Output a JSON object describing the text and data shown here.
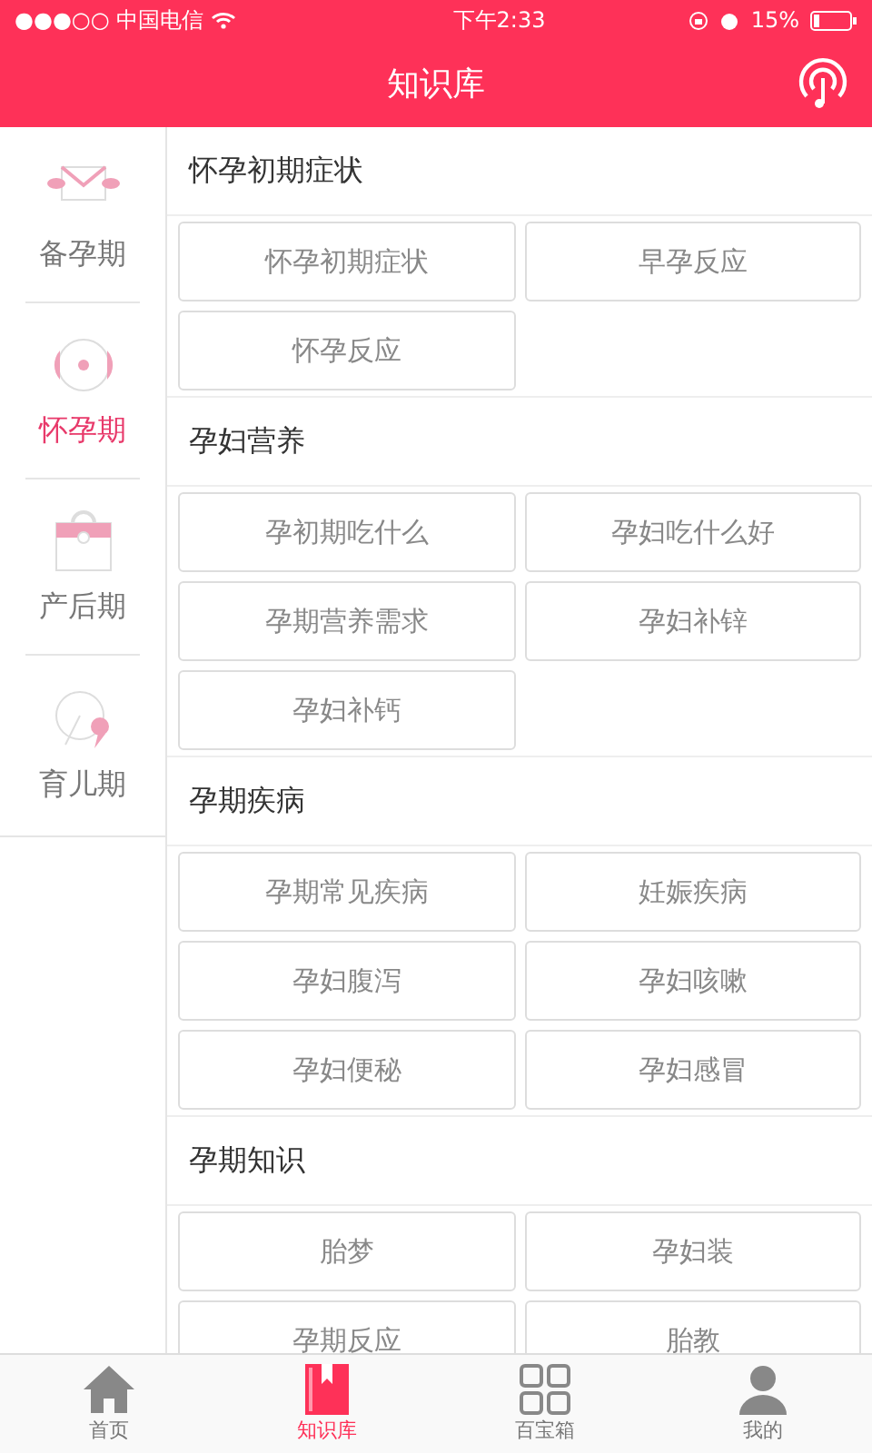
{
  "status_bar": {
    "carrier": "●●●○○ 中国电信",
    "time": "下午2:33",
    "battery": "15%"
  },
  "header": {
    "title": "知识库"
  },
  "sidebar": {
    "items": [
      {
        "label": "备孕期",
        "kind": "envelope",
        "selected": false
      },
      {
        "label": "怀孕期",
        "kind": "target",
        "selected": true
      },
      {
        "label": "产后期",
        "kind": "bag",
        "selected": false
      },
      {
        "label": "育儿期",
        "kind": "baby",
        "selected": false
      }
    ]
  },
  "sections": [
    {
      "title": "怀孕初期症状",
      "items": [
        "怀孕初期症状",
        "早孕反应",
        "怀孕反应"
      ]
    },
    {
      "title": "孕妇营养",
      "items": [
        "孕初期吃什么",
        "孕妇吃什么好",
        "孕期营养需求",
        "孕妇补锌",
        "孕妇补钙"
      ]
    },
    {
      "title": "孕期疾病",
      "items": [
        "孕期常见疾病",
        "妊娠疾病",
        "孕妇腹泻",
        "孕妇咳嗽",
        "孕妇便秘",
        "孕妇感冒"
      ]
    },
    {
      "title": "孕期知识",
      "items": [
        "胎梦",
        "孕妇装",
        "孕期反应",
        "胎教"
      ]
    }
  ],
  "tab_bar": [
    {
      "label": "首页",
      "kind": "home",
      "selected": false
    },
    {
      "label": "知识库",
      "kind": "book",
      "selected": true
    },
    {
      "label": "百宝箱",
      "kind": "grid",
      "selected": false
    },
    {
      "label": "我的",
      "kind": "person",
      "selected": false
    }
  ]
}
